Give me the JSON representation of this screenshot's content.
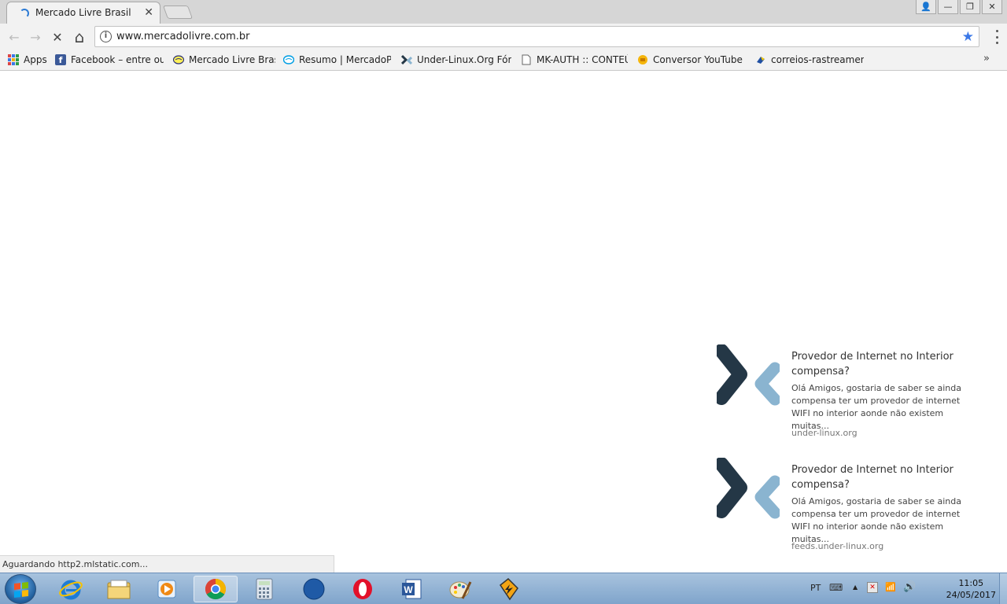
{
  "browser": {
    "tab": {
      "title": "Mercado Livre Brasil",
      "close": "✕"
    },
    "window_buttons": [
      "person-icon",
      "minimize-icon",
      "restore-icon",
      "close-icon"
    ],
    "window_glyphs": {
      "person": "👤",
      "minimize": "—",
      "restore": "❐",
      "close": "✕"
    },
    "nav": {
      "back": "←",
      "forward": "→",
      "stop": "✕",
      "home": "⌂"
    },
    "address": {
      "url": "www.mercadolivre.com.br",
      "info": "i",
      "star": "★"
    },
    "bookmarks": [
      {
        "label": "Apps",
        "icon": "apps-grid-icon"
      },
      {
        "label": "Facebook – entre ou c",
        "icon": "facebook-icon"
      },
      {
        "label": "Mercado Livre Brasil",
        "icon": "mercadolivre-icon"
      },
      {
        "label": "Resumo | MercadoPag",
        "icon": "mercadopago-icon"
      },
      {
        "label": "Under-Linux.Org Fóru",
        "icon": "underlinux-icon"
      },
      {
        "label": "MK-AUTH :: CONTEÚ",
        "icon": "page-icon"
      },
      {
        "label": "Conversor YouTube p",
        "icon": "converter-icon"
      },
      {
        "label": "correios-rastreament",
        "icon": "correios-icon"
      }
    ],
    "more_bookmarks": "»",
    "status_text": "Aguardando http2.mlstatic.com..."
  },
  "notifications": [
    {
      "title": "Provedor de Internet no Interior compensa?",
      "body": "Olá Amigos, gostaria de saber se ainda compensa ter um provedor de internet WIFI no interior aonde não existem muitas...",
      "source": "under-linux.org"
    },
    {
      "title": "Provedor de Internet no Interior compensa?",
      "body": "Olá Amigos, gostaria de saber se ainda compensa ter um provedor de internet WIFI no interior aonde não existem muitas...",
      "source": "feeds.under-linux.org"
    }
  ],
  "taskbar": {
    "apps": [
      "internet-explorer-icon",
      "file-explorer-icon",
      "media-player-icon",
      "chrome-icon",
      "calculator-icon",
      "moon-app-icon",
      "opera-icon",
      "word-icon",
      "paint-icon",
      "winamp-icon"
    ],
    "word_letter": "W",
    "tray": {
      "language": "PT",
      "time": "11:05",
      "date": "24/05/2017"
    },
    "tray_glyphs": {
      "keyboard": "⌨",
      "arrow": "▲",
      "network": "✕",
      "signal": "📶",
      "volume": "🔊"
    }
  },
  "colors": {
    "accent": "#3b78e7",
    "logo_dark": "#243746",
    "logo_light": "#8ab4d0"
  }
}
